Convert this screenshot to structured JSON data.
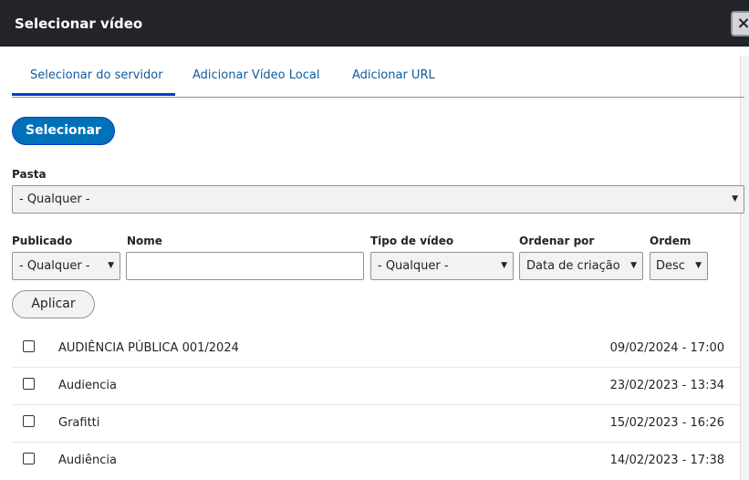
{
  "dialog": {
    "title": "Selecionar vídeo",
    "close_label": "×"
  },
  "tabs": [
    {
      "label": "Selecionar do servidor",
      "active": true
    },
    {
      "label": "Adicionar Vídeo Local",
      "active": false
    },
    {
      "label": "Adicionar URL",
      "active": false
    }
  ],
  "select_button": "Selecionar",
  "filters": {
    "folder_label": "Pasta",
    "folder_value": "- Qualquer -",
    "published_label": "Publicado",
    "published_value": "- Qualquer -",
    "name_label": "Nome",
    "name_value": "",
    "type_label": "Tipo de vídeo",
    "type_value": "- Qualquer -",
    "sort_label": "Ordenar por",
    "sort_value": "Data de criação",
    "order_label": "Ordem",
    "order_value": "Desc"
  },
  "apply_button": "Aplicar",
  "caret": "▼",
  "videos": [
    {
      "name": "AUDIÊNCIA PÚBLICA 001/2024",
      "date": "09/02/2024 - 17:00"
    },
    {
      "name": "Audiencia",
      "date": "23/02/2023 - 13:34"
    },
    {
      "name": "Grafitti",
      "date": "15/02/2023 - 16:26"
    },
    {
      "name": "Audiência",
      "date": "14/02/2023 - 17:38"
    }
  ],
  "colors": {
    "titlebar": "#232429",
    "accent": "#0071b8",
    "tab_text": "#0f5a9c"
  }
}
